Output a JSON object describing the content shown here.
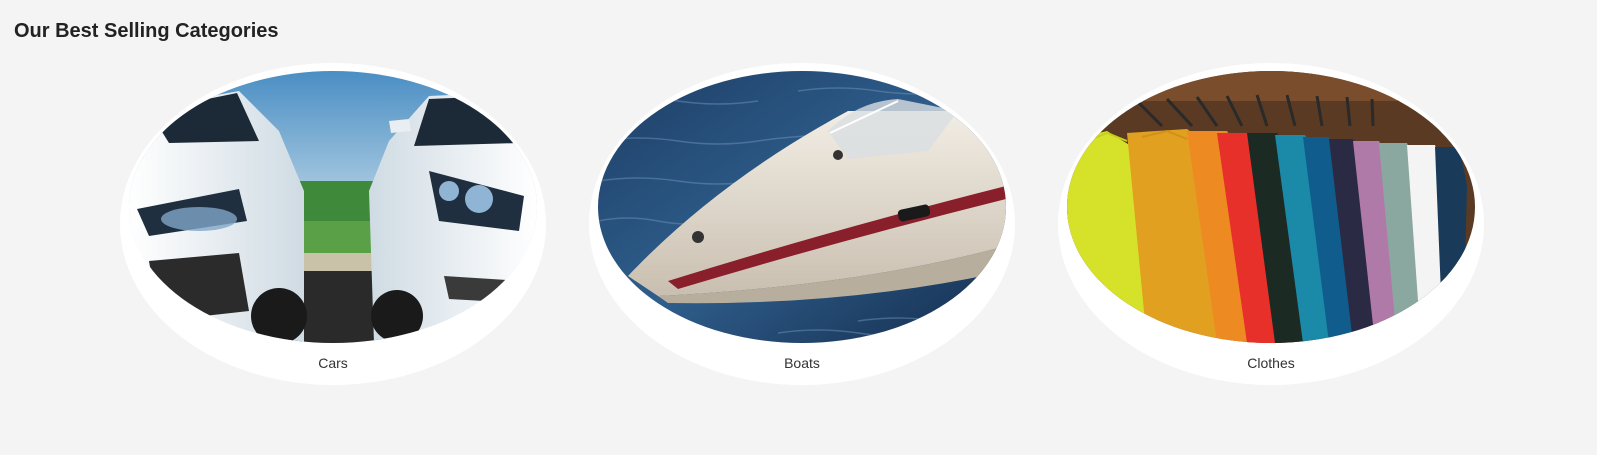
{
  "section": {
    "title": "Our Best Selling Categories"
  },
  "categories": [
    {
      "label": "Cars",
      "image": "white sports cars parked facing each other"
    },
    {
      "label": "Boats",
      "image": "white speedboat on blue water"
    },
    {
      "label": "Clothes",
      "image": "colorful t-shirts on hangers"
    }
  ],
  "colors": {
    "page_background": "#f4f4f4",
    "card_background": "#ffffff",
    "title_text": "#222222",
    "label_text": "#333333"
  }
}
